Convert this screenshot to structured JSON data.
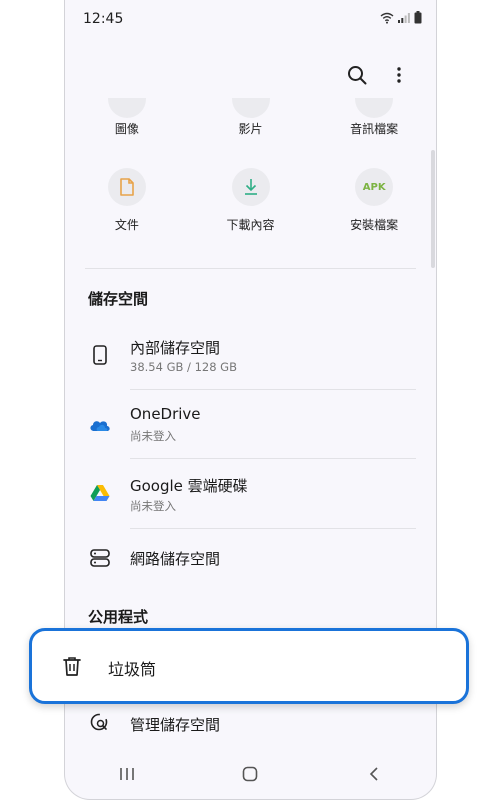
{
  "status_bar": {
    "time": "12:45"
  },
  "categories_partial": [
    {
      "label": "圖像",
      "icon": "image-icon"
    },
    {
      "label": "影片",
      "icon": "video-icon"
    },
    {
      "label": "音訊檔案",
      "icon": "audio-icon"
    }
  ],
  "categories": [
    {
      "label": "文件",
      "icon": "document-icon"
    },
    {
      "label": "下載內容",
      "icon": "download-icon"
    },
    {
      "label": "安裝檔案",
      "icon": "apk-icon",
      "badge": "APK"
    }
  ],
  "storage": {
    "title": "儲存空間",
    "items": [
      {
        "title": "內部儲存空間",
        "subtitle": "38.54 GB / 128 GB",
        "icon": "phone-icon"
      },
      {
        "title": "OneDrive",
        "subtitle": "尚未登入",
        "icon": "onedrive-icon"
      },
      {
        "title": "Google 雲端硬碟",
        "subtitle": "尚未登入",
        "icon": "google-drive-icon"
      },
      {
        "title": "網路儲存空間",
        "icon": "network-storage-icon"
      }
    ]
  },
  "utilities": {
    "title": "公用程式",
    "trash_label": "垃圾筒",
    "manage_label": "管理儲存空間"
  },
  "colors": {
    "highlight": "#1a73d9",
    "doc_icon": "#e8a34a",
    "download_icon": "#2fae86",
    "apk_badge": "#7cb342"
  }
}
